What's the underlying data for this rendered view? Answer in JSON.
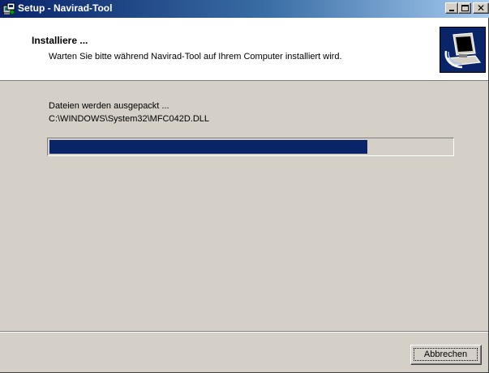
{
  "window": {
    "title": "Setup - Navirad-Tool",
    "app_icon": "setup-installer-icon",
    "controls": {
      "minimize_icon": "minimize-icon",
      "maximize_icon": "maximize-icon",
      "close_icon": "close-icon",
      "close_glyph": "✕"
    }
  },
  "header": {
    "title": "Installiere ...",
    "subtitle": "Warten Sie bitte während Navirad-Tool auf Ihrem Computer installiert wird.",
    "icon": "computer-install-icon"
  },
  "body": {
    "status": "Dateien werden ausgepackt ...",
    "current_file": "C:\\WINDOWS\\System32\\MFC042D.DLL",
    "progress": 0.79
  },
  "footer": {
    "cancel_label": "Abbrechen"
  },
  "colors": {
    "titlebar_start": "#0a246a",
    "titlebar_end": "#a6caf0",
    "progress_fill": "#0a246a",
    "dialog_face": "#d4d0c8"
  }
}
